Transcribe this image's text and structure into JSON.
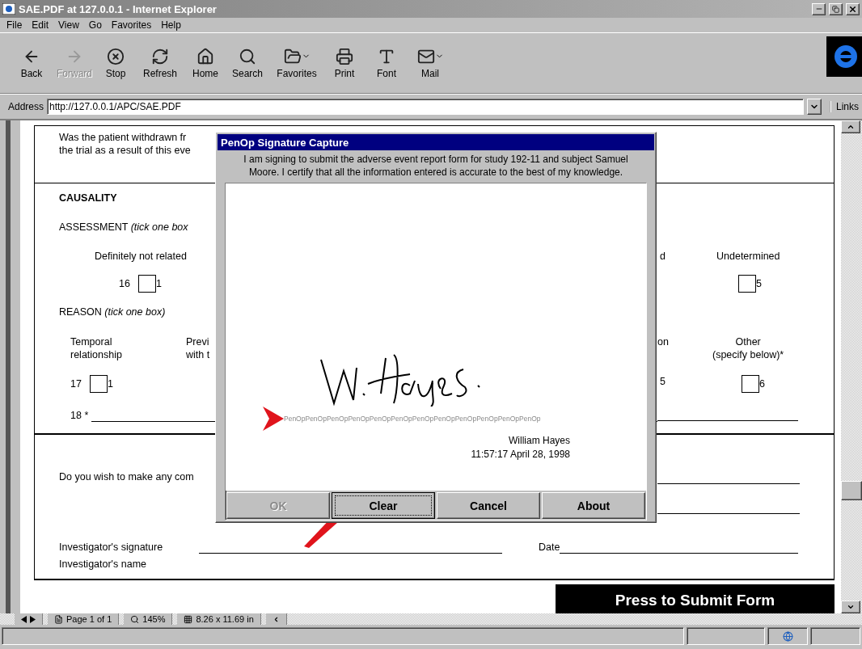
{
  "window": {
    "title": "SAE.PDF at 127.0.0.1 - Internet Explorer"
  },
  "menu": [
    "File",
    "Edit",
    "View",
    "Go",
    "Favorites",
    "Help"
  ],
  "toolbar": [
    {
      "label": "Back",
      "disabled": false
    },
    {
      "label": "Forward",
      "disabled": true
    },
    {
      "label": "Stop",
      "disabled": false
    },
    {
      "label": "Refresh",
      "disabled": false
    },
    {
      "label": "Home",
      "disabled": false
    },
    {
      "label": "Search",
      "disabled": false
    },
    {
      "label": "Favorites",
      "disabled": false
    },
    {
      "label": "Print",
      "disabled": false
    },
    {
      "label": "Font",
      "disabled": false
    },
    {
      "label": "Mail",
      "disabled": false
    }
  ],
  "address": {
    "label": "Address",
    "value": "http://127.0.0.1/APC/SAE.PDF",
    "links": "Links"
  },
  "form": {
    "withdrawn_question": [
      "Was the patient withdrawn fr",
      "the trial as a result of this eve"
    ],
    "causality_heading": "CAUSALITY",
    "assessment": {
      "label": "ASSESSMENT *(tick one box*",
      "left": {
        "label": "Definitely not related",
        "field_number": "16",
        "code": "1",
        "checked": false
      },
      "fragment": "d",
      "right": {
        "label": "Undetermined",
        "code": "5",
        "checked": false
      }
    },
    "reason": {
      "label": "REASON *(tick one box)*",
      "left": {
        "label": [
          "Temporal",
          "relationship"
        ],
        "field_number": "17",
        "code": "1",
        "checked": false
      },
      "partial": [
        "Previ",
        "with t"
      ],
      "fragment": "on",
      "fragment_code": "5",
      "right": {
        "label": [
          "Other",
          "(specify below)*"
        ],
        "code": "6",
        "checked": false
      }
    },
    "other_field": "18 *",
    "comments_question": "Do you wish to make any com",
    "signature_label": "Investigator's signature",
    "date_label": "Date",
    "name_label": "Investigator's name",
    "submit_button": "Press to Submit Form"
  },
  "dialog": {
    "title": "PenOp Signature Capture",
    "message": "I am signing to submit the adverse event report form for study 192-11 and subject Samuel Moore.  I certify that all the information entered is accurate to the best of my knowledge.",
    "baseline": "PenOpPenOpPenOpPenOpPenOpPenOpPenOpPenOpPenOpPenOpPenOpPenOp",
    "signer": "William Hayes",
    "timestamp": "11:57:17 April 28, 1998",
    "buttons": [
      {
        "label": "OK",
        "disabled": true,
        "focused": false
      },
      {
        "label": "Clear",
        "disabled": false,
        "focused": true
      },
      {
        "label": "Cancel",
        "disabled": false,
        "focused": false
      },
      {
        "label": "About",
        "disabled": false,
        "focused": false
      }
    ]
  },
  "pdf_bar": {
    "page": "Page 1 of 1",
    "zoom": "145%",
    "size": "8.26 x 11.69 in"
  }
}
